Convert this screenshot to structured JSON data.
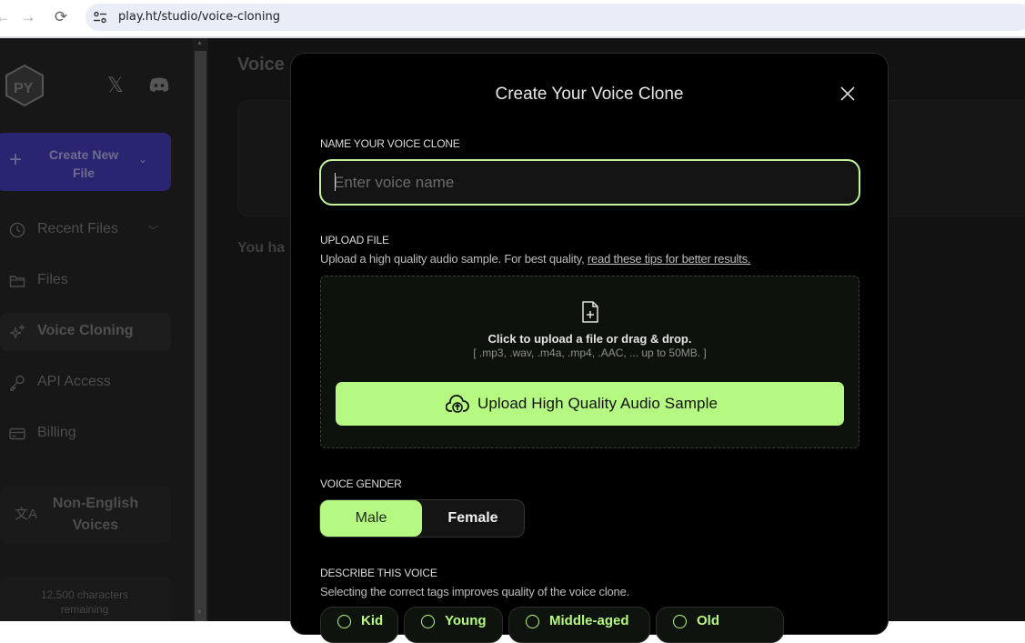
{
  "browser": {
    "url": "play.ht/studio/voice-cloning",
    "back_icon": "←",
    "forward_icon": "→",
    "reload_icon": "⟳"
  },
  "sidebar": {
    "create_button": {
      "label": "Create New File",
      "plus": "+",
      "chevron": "⌄"
    },
    "social_x": "𝕏",
    "items": [
      {
        "label": "Recent Files",
        "icon": "clock-icon",
        "chevron": "﹀"
      },
      {
        "label": "Files",
        "icon": "folder-icon"
      },
      {
        "label": "Voice Cloning",
        "icon": "sparkles-icon",
        "active": true
      },
      {
        "label": "API Access",
        "icon": "key-icon"
      },
      {
        "label": "Billing",
        "icon": "credit-card-icon"
      }
    ],
    "non_english": {
      "label": "Non-English Voices",
      "icon": "文A"
    },
    "characters_remaining": "12,500 characters remaining"
  },
  "main": {
    "title": "Voice",
    "note": "You ha"
  },
  "modal": {
    "title": "Create Your Voice Clone",
    "name_section": {
      "label": "NAME YOUR VOICE CLONE",
      "placeholder": "Enter voice name",
      "value": ""
    },
    "upload_section": {
      "label": "UPLOAD FILE",
      "description": "Upload a high quality audio sample. For best quality, ",
      "link_text": "read these tips for better results.",
      "dropzone_text": "Click to upload a file or drag & drop.",
      "dropzone_formats": "[ .mp3, .wav, .m4a, .mp4, .AAC, ... up to 50MB. ]",
      "upload_button": "Upload High Quality Audio Sample"
    },
    "gender_section": {
      "label": "VOICE GENDER",
      "options": [
        "Male",
        "Female"
      ],
      "selected": "Male"
    },
    "describe_section": {
      "label": "DESCRIBE THIS VOICE",
      "description": "Selecting the correct tags improves quality of the voice clone.",
      "tags": [
        "Kid",
        "Young",
        "Middle-aged",
        "Old"
      ]
    }
  },
  "colors": {
    "accent": "#b5f882",
    "modal_bg": "#000000",
    "app_bg": "#121212",
    "create_button": "#2a2570"
  }
}
